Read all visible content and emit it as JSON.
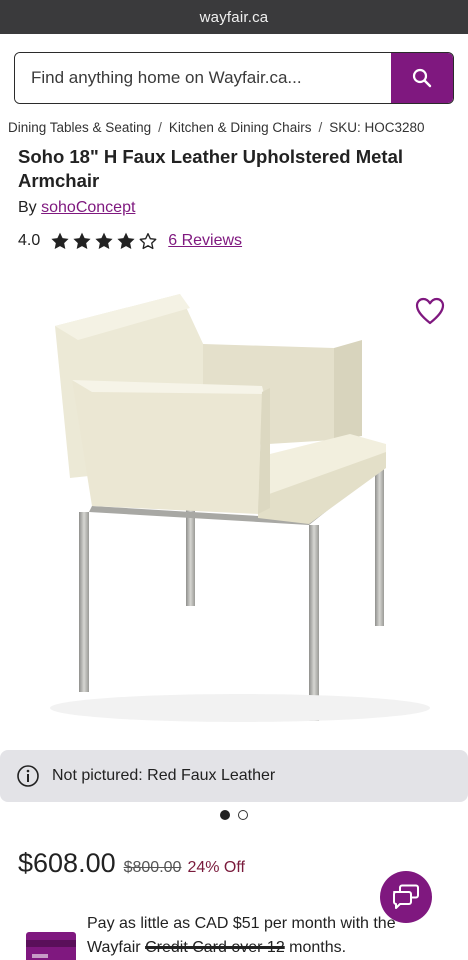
{
  "browser": {
    "url": "wayfair.ca"
  },
  "search": {
    "placeholder": "Find anything home on Wayfair.ca..."
  },
  "breadcrumb": {
    "items": [
      "Dining Tables & Seating",
      "Kitchen & Dining Chairs"
    ],
    "sku": "SKU: HOC3280",
    "separator": "/"
  },
  "product": {
    "title": "Soho 18\" H Faux Leather Upholstered Metal Armchair",
    "by_label": "By",
    "brand": "sohoConcept",
    "rating": "4.0",
    "rating_stars": 4,
    "max_stars": 5,
    "reviews_label": "6 Reviews",
    "note": "Not pictured: Red Faux Leather",
    "image_count": 2,
    "active_image": 1
  },
  "pricing": {
    "current": "$608.00",
    "original": "$800.00",
    "discount": "24% Off"
  },
  "financing": {
    "line1": "Pay as little as CAD $51 per month with the",
    "line2_start": "Wayfair",
    "line2_struck": "Credit Card over 12",
    "line2_end": "months."
  },
  "icons": {
    "search": "search-icon",
    "heart": "heart-icon",
    "info": "info-icon",
    "chat": "chat-icon",
    "star_full": "star-filled-icon",
    "star_empty": "star-outline-icon",
    "card": "credit-card-icon"
  },
  "colors": {
    "brand_purple": "#7f187f",
    "discount_red": "#7a1b3c",
    "banner_gray": "#e3e3e7"
  }
}
